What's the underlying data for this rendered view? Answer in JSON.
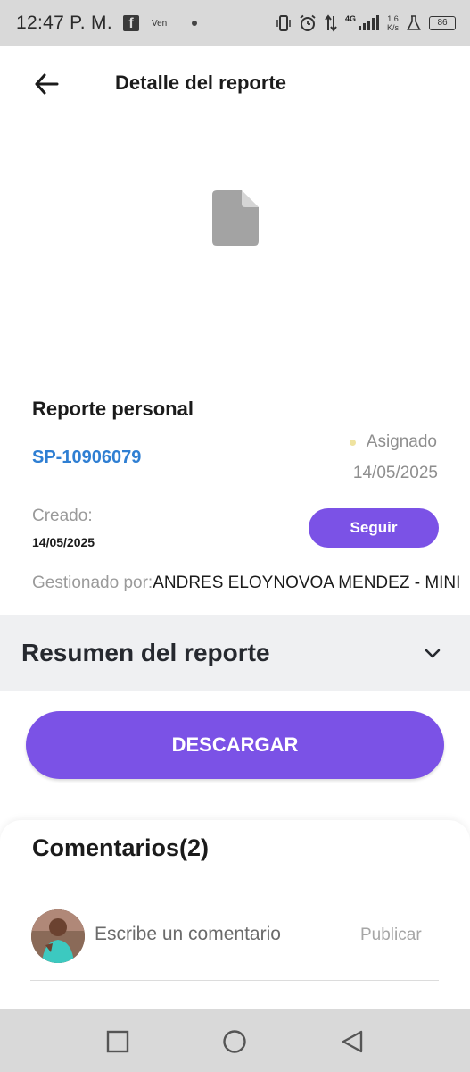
{
  "status_bar": {
    "time": "12:47 P. M.",
    "facebook_glyph": "f",
    "carrier_label": "Ven",
    "network": "4G",
    "speed_value": "1.6",
    "speed_unit": "K/s",
    "battery": "86"
  },
  "header": {
    "title": "Detalle del reporte",
    "back_icon": "arrow-left-icon"
  },
  "document_icon": "file-icon",
  "report": {
    "type": "Reporte personal",
    "id": "SP-10906079",
    "status": "Asignado",
    "status_color": "#efe3a0",
    "status_date": "14/05/2025",
    "created_label": "Creado:",
    "created_date": "14/05/2025",
    "follow_label": "Seguir",
    "managed_label": "Gestionado por:",
    "managed_value": "ANDRES ELOYNOVOA MENDEZ - MINI"
  },
  "summary": {
    "title": "Resumen del reporte",
    "icon": "chevron-down-icon"
  },
  "download_label": "DESCARGAR",
  "comments": {
    "title": "Comentarios(2)",
    "input_placeholder": "Escribe un comentario",
    "publish_label": "Publicar"
  },
  "colors": {
    "accent": "#7b52e6",
    "id_link": "#2f7fd3"
  }
}
